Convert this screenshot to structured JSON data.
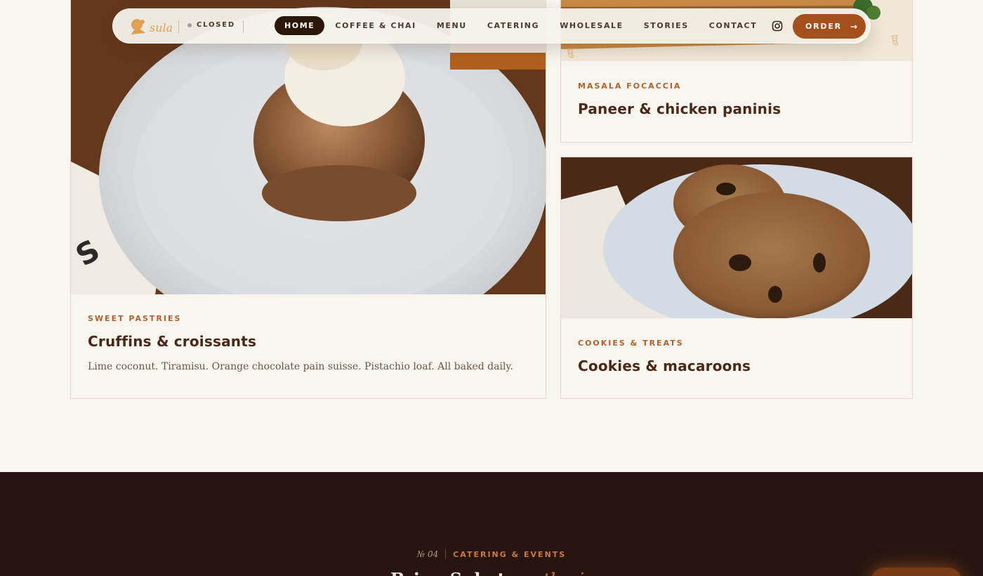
{
  "nav": {
    "brand": "sula",
    "status": "CLOSED",
    "links": [
      "HOME",
      "COFFEE & CHAI",
      "MENU",
      "CATERING",
      "WHOLESALE",
      "STORIES",
      "CONTACT"
    ],
    "order_label": "ORDER",
    "colors": {
      "active_bg": "#2c160c",
      "order_bg": "#a54f1d"
    }
  },
  "cards": {
    "focaccia": {
      "eyebrow": "MASALA FOCACCIA",
      "title": "Paneer & chicken paninis"
    },
    "pastries": {
      "eyebrow": "SWEET PASTRIES",
      "title": "Cruffins & croissants",
      "desc": "Lime coconut. Tiramisu. Orange chocolate pain suisse. Pistachio loaf. All baked daily."
    },
    "cookies": {
      "eyebrow": "COOKIES & TREATS",
      "title": "Cookies & macaroons"
    }
  },
  "catering": {
    "number": "№ 04",
    "eyebrow": "CATERING & EVENTS",
    "heading_start": "Bring Sula to",
    "heading_accent": "gatherings"
  },
  "icons": [
    "instagram-icon",
    "arrow-right-icon",
    "logo-mark-icon"
  ],
  "accent": "#b2602d"
}
